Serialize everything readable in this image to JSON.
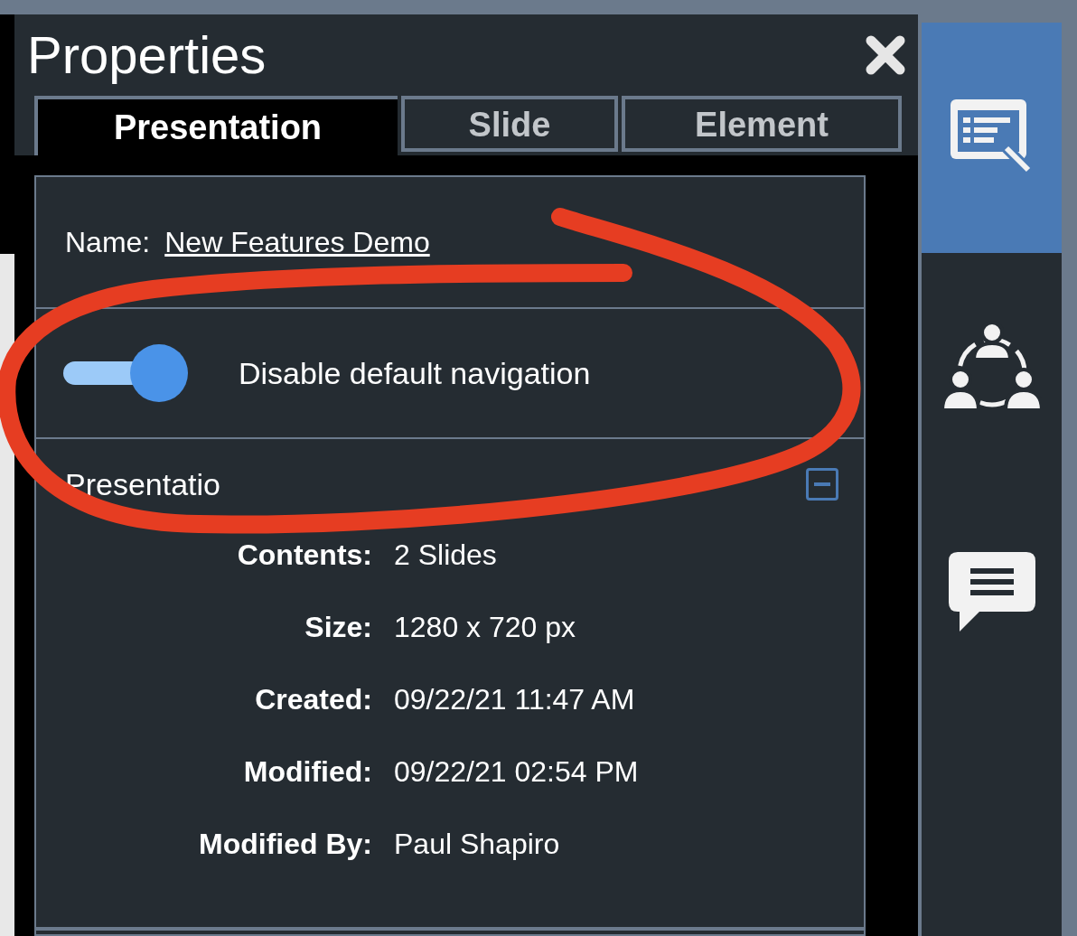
{
  "panel": {
    "title": "Properties"
  },
  "tabs": [
    {
      "label": "Presentation",
      "selected": true
    },
    {
      "label": "Slide",
      "selected": false
    },
    {
      "label": "Element",
      "selected": false
    }
  ],
  "name_field": {
    "label": "Name:",
    "value": "New Features Demo"
  },
  "toggle": {
    "label": "Disable default navigation",
    "on": true
  },
  "section": {
    "title": "Presentatio",
    "expanded": true
  },
  "details": [
    {
      "label": "Contents:",
      "value": "2 Slides"
    },
    {
      "label": "Size:",
      "value": "1280 x 720 px"
    },
    {
      "label": "Created:",
      "value": "09/22/21 11:47 AM"
    },
    {
      "label": "Modified:",
      "value": "09/22/21 02:54 PM"
    },
    {
      "label": "Modified By:",
      "value": "Paul Shapiro"
    }
  ],
  "sidebar": {
    "items": [
      {
        "kind": "properties",
        "selected": true
      },
      {
        "kind": "collaborators",
        "selected": false
      },
      {
        "kind": "comments",
        "selected": false
      }
    ]
  }
}
